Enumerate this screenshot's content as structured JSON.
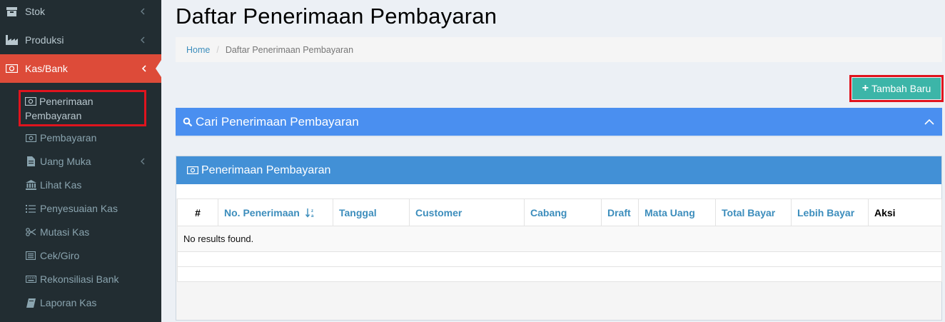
{
  "sidebar": {
    "items": [
      {
        "label": "Stok",
        "icon": "archive-icon"
      },
      {
        "label": "Produksi",
        "icon": "industry-icon"
      },
      {
        "label": "Kas/Bank",
        "icon": "money-icon",
        "active": true
      }
    ],
    "submenu": [
      {
        "label": "Penerimaan Pembayaran",
        "icon": "money-icon"
      },
      {
        "label": "Pembayaran",
        "icon": "money-icon"
      },
      {
        "label": "Uang Muka",
        "icon": "file-icon"
      },
      {
        "label": "Lihat Kas",
        "icon": "bank-icon"
      },
      {
        "label": "Penyesuaian Kas",
        "icon": "list-ol-icon"
      },
      {
        "label": "Mutasi Kas",
        "icon": "scissors-icon"
      },
      {
        "label": "Cek/Giro",
        "icon": "list-alt-icon"
      },
      {
        "label": "Rekonsiliasi Bank",
        "icon": "keyboard-icon"
      },
      {
        "label": "Laporan Kas",
        "icon": "book-icon"
      }
    ]
  },
  "header": {
    "title": "Daftar Penerimaan Pembayaran"
  },
  "breadcrumb": {
    "home": "Home",
    "current": "Daftar Penerimaan Pembayaran"
  },
  "actions": {
    "add_label": "Tambah Baru"
  },
  "search": {
    "title": "Cari Penerimaan Pembayaran"
  },
  "table_panel": {
    "title": "Penerimaan Pembayaran",
    "columns": [
      "#",
      "No. Penerimaan",
      "Tanggal",
      "Customer",
      "Cabang",
      "Draft",
      "Mata Uang",
      "Total Bayar",
      "Lebih Bayar",
      "Aksi"
    ],
    "empty_text": "No results found."
  },
  "colors": {
    "sidebar_bg": "#222d32",
    "active_bg": "#dd4b39",
    "button_bg": "#3cb5a8",
    "search_bg": "#4a8ff0",
    "panel_head_bg": "#4290d6",
    "link": "#3c8dbc"
  }
}
